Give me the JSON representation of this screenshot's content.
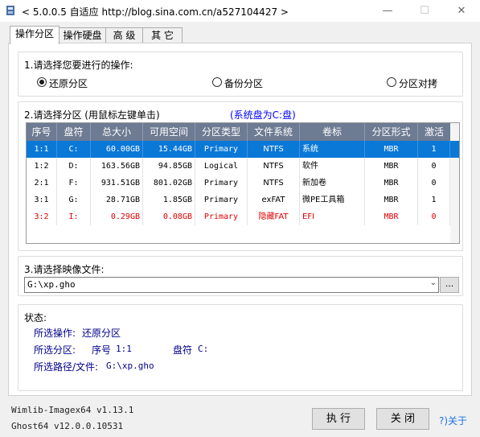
{
  "window": {
    "title": "< 5.0.0.5 自适应 http://blog.sina.com.cn/a527104427 >",
    "minimize": "—",
    "maximize": "☐",
    "close": "✕"
  },
  "tabs": [
    "操作分区",
    "操作硬盘",
    "高 级",
    "其 它"
  ],
  "operation": {
    "prompt": "1.请选择您要进行的操作:",
    "options": [
      "还原分区",
      "备份分区",
      "分区对拷"
    ],
    "selected": "还原分区"
  },
  "partition": {
    "prompt": "2.请选择分区 (用鼠标左键单击)",
    "system_disk": "(系统盘为C:盘)",
    "columns": [
      "序号",
      "盘符",
      "总大小",
      "可用空间",
      "分区类型",
      "文件系统",
      "卷标",
      "分区形式",
      "激活"
    ],
    "rows": [
      {
        "idx": "1:1",
        "letter": "C:",
        "total": "60.00GB",
        "free": "15.44GB",
        "type": "Primary",
        "fs": "NTFS",
        "label": "系统",
        "form": "MBR",
        "active": "1",
        "state": "selected"
      },
      {
        "idx": "1:2",
        "letter": "D:",
        "total": "163.56GB",
        "free": "94.85GB",
        "type": "Logical",
        "fs": "NTFS",
        "label": "软件",
        "form": "MBR",
        "active": "0",
        "state": "normal"
      },
      {
        "idx": "2:1",
        "letter": "F:",
        "total": "931.51GB",
        "free": "801.02GB",
        "type": "Primary",
        "fs": "NTFS",
        "label": "新加卷",
        "form": "MBR",
        "active": "0",
        "state": "normal"
      },
      {
        "idx": "3:1",
        "letter": "G:",
        "total": "28.71GB",
        "free": "1.85GB",
        "type": "Primary",
        "fs": "exFAT",
        "label": "微PE工具箱",
        "form": "MBR",
        "active": "1",
        "state": "normal"
      },
      {
        "idx": "3:2",
        "letter": "I:",
        "total": "0.29GB",
        "free": "0.08GB",
        "type": "Primary",
        "fs": "隐藏FAT",
        "label": "EFI",
        "form": "MBR",
        "active": "0",
        "state": "hidden"
      }
    ]
  },
  "image": {
    "prompt": "3.请选择映像文件:",
    "value": "G:\\xp.gho",
    "browse": "..."
  },
  "status": {
    "title": "状态:",
    "op_label": "所选操作:",
    "op_value": "还原分区",
    "part_label": "所选分区:",
    "part_idx_label": "序号",
    "part_idx": "1:1",
    "part_letter_label": "盘符",
    "part_letter": "C:",
    "path_label": "所选路径/文件:",
    "path_value": "G:\\xp.gho"
  },
  "footer": {
    "wimlib": "Wimlib-Imagex64 v1.13.1",
    "ghost": "Ghost64 v12.0.0.10531",
    "execute": "执 行",
    "close": "关 闭",
    "about": "?)关于"
  },
  "colors": {
    "header_bg": "#6d7b93",
    "selected_row": "#0a78d7",
    "hidden_row_text": "#e00000",
    "link_blue": "#0000ff",
    "status_text": "#00008b"
  }
}
